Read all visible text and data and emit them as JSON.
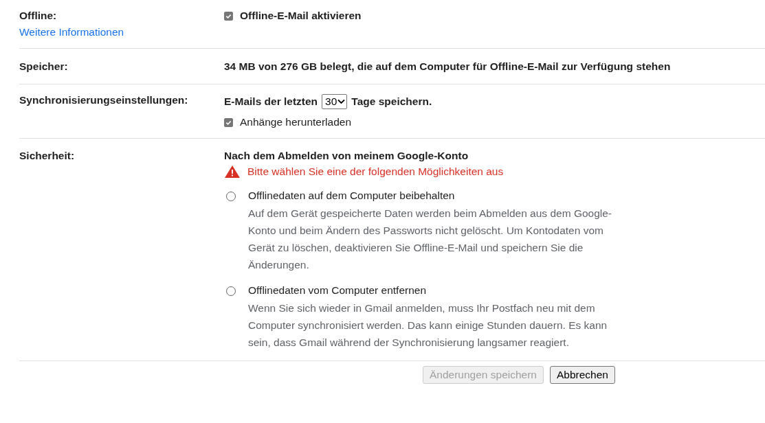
{
  "offline": {
    "label": "Offline:",
    "link": "Weitere Informationen",
    "checkbox": {
      "label": "Offline-E-Mail aktivieren",
      "checked": true
    }
  },
  "storage": {
    "label": "Speicher:",
    "text": "34 MB von 276 GB belegt, die auf dem Computer für Offline-E-Mail zur Verfügung stehen"
  },
  "sync": {
    "label": "Synchronisierungseinstellungen:",
    "prefix": "E-Mails der letzten",
    "days": "30",
    "suffix": "Tage speichern.",
    "attachments": {
      "label": "Anhänge herunterladen",
      "checked": true
    }
  },
  "security": {
    "label": "Sicherheit:",
    "heading": "Nach dem Abmelden von meinem Google-Konto",
    "warning": "Bitte wählen Sie eine der folgenden Möglichkeiten aus",
    "options": [
      {
        "title": "Offlinedaten auf dem Computer beibehalten",
        "description": "Auf dem Gerät gespeicherte Daten werden beim Abmelden aus dem Google-Konto und beim Ändern des Passworts nicht gelöscht. Um Kontodaten vom Gerät zu löschen, deaktivieren Sie Offline-E-Mail und speichern Sie die Änderungen.",
        "selected": false
      },
      {
        "title": "Offlinedaten vom Computer entfernen",
        "description": "Wenn Sie sich wieder in Gmail anmelden, muss Ihr Postfach neu mit dem Computer synchronisiert werden. Das kann einige Stunden dauern. Es kann sein, dass Gmail während der Synchronisierung langsamer reagiert.",
        "selected": false
      }
    ]
  },
  "buttons": [
    {
      "label": "Änderungen speichern",
      "disabled": true
    },
    {
      "label": "Abbrechen",
      "disabled": false
    }
  ]
}
